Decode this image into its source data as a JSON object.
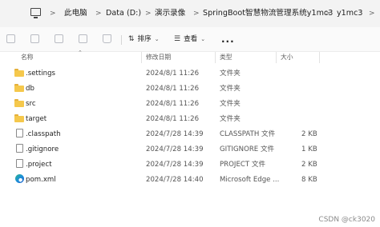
{
  "breadcrumb": {
    "items": [
      "此电脑",
      "Data (D:)",
      "演示录像",
      "SpringBoot智慧物流管理系统y1mc3",
      "y1mc3"
    ],
    "separator": ">"
  },
  "toolbar": {
    "sort_label": "排序",
    "view_label": "查看",
    "more_label": "..."
  },
  "columns": [
    "名称",
    "修改日期",
    "类型",
    "大小"
  ],
  "files": [
    {
      "name": ".settings",
      "modified": "2024/8/1 11:26",
      "type": "文件夹",
      "size": "",
      "icon": "folder-icon"
    },
    {
      "name": "db",
      "modified": "2024/8/1 11:26",
      "type": "文件夹",
      "size": "",
      "icon": "folder-icon"
    },
    {
      "name": "src",
      "modified": "2024/8/1 11:26",
      "type": "文件夹",
      "size": "",
      "icon": "folder-icon"
    },
    {
      "name": "target",
      "modified": "2024/8/1 11:26",
      "type": "文件夹",
      "size": "",
      "icon": "folder-icon"
    },
    {
      "name": ".classpath",
      "modified": "2024/7/28 14:39",
      "type": "CLASSPATH 文件",
      "size": "2 KB",
      "icon": "file-icon"
    },
    {
      "name": ".gitignore",
      "modified": "2024/7/28 14:39",
      "type": "GITIGNORE 文件",
      "size": "1 KB",
      "icon": "file-icon"
    },
    {
      "name": ".project",
      "modified": "2024/7/28 14:39",
      "type": "PROJECT 文件",
      "size": "2 KB",
      "icon": "file-icon"
    },
    {
      "name": "pom.xml",
      "modified": "2024/7/28 14:40",
      "type": "Microsoft Edge ...",
      "size": "8 KB",
      "icon": "edge-icon"
    }
  ],
  "watermark": "CSDN @ck3020",
  "colors": {
    "folder": "#f5c84c",
    "address_bar_bg": "#f3f3f3"
  }
}
